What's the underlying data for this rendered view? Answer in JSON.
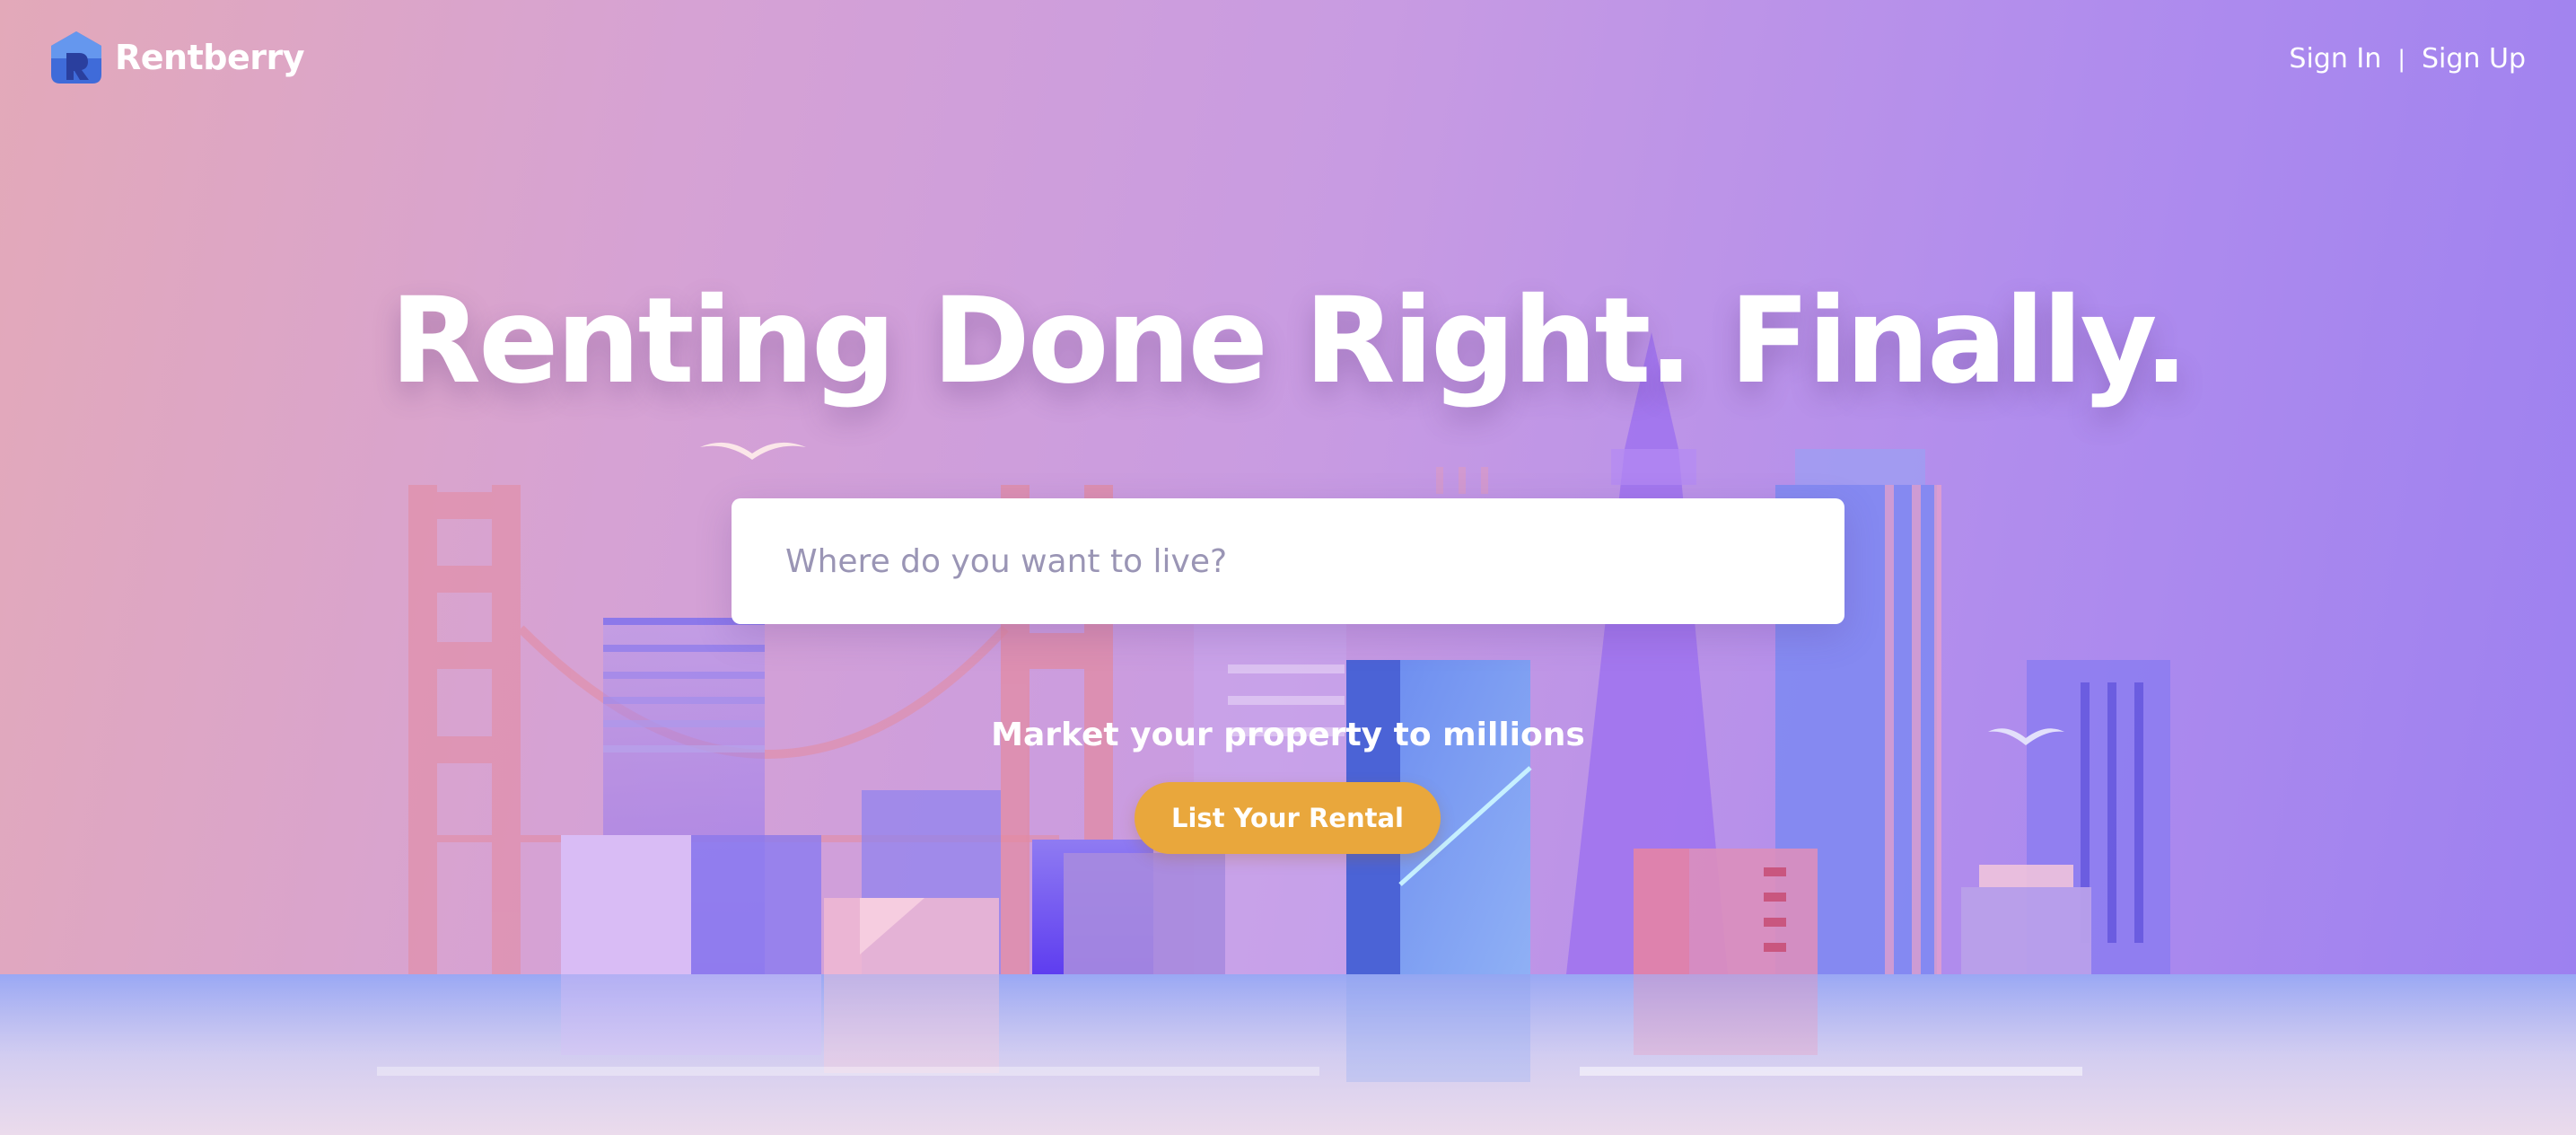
{
  "header": {
    "brand_name": "Rentberry",
    "sign_in_label": "Sign In",
    "separator": "|",
    "sign_up_label": "Sign Up"
  },
  "hero": {
    "title": "Renting Done Right. Finally.",
    "search_placeholder": "Where do you want to live?",
    "market_text": "Market your property to millions",
    "list_rental_label": "List Your Rental"
  },
  "colors": {
    "accent_button": "#e9a73c",
    "logo_blue": "#3f6bd9",
    "background_left": "#e3a9b9",
    "background_right": "#9c80f0"
  },
  "icons": {
    "logo": "rentberry-house-logo-icon",
    "decorative": [
      "bird-icon",
      "city-skyline-illustration"
    ]
  }
}
